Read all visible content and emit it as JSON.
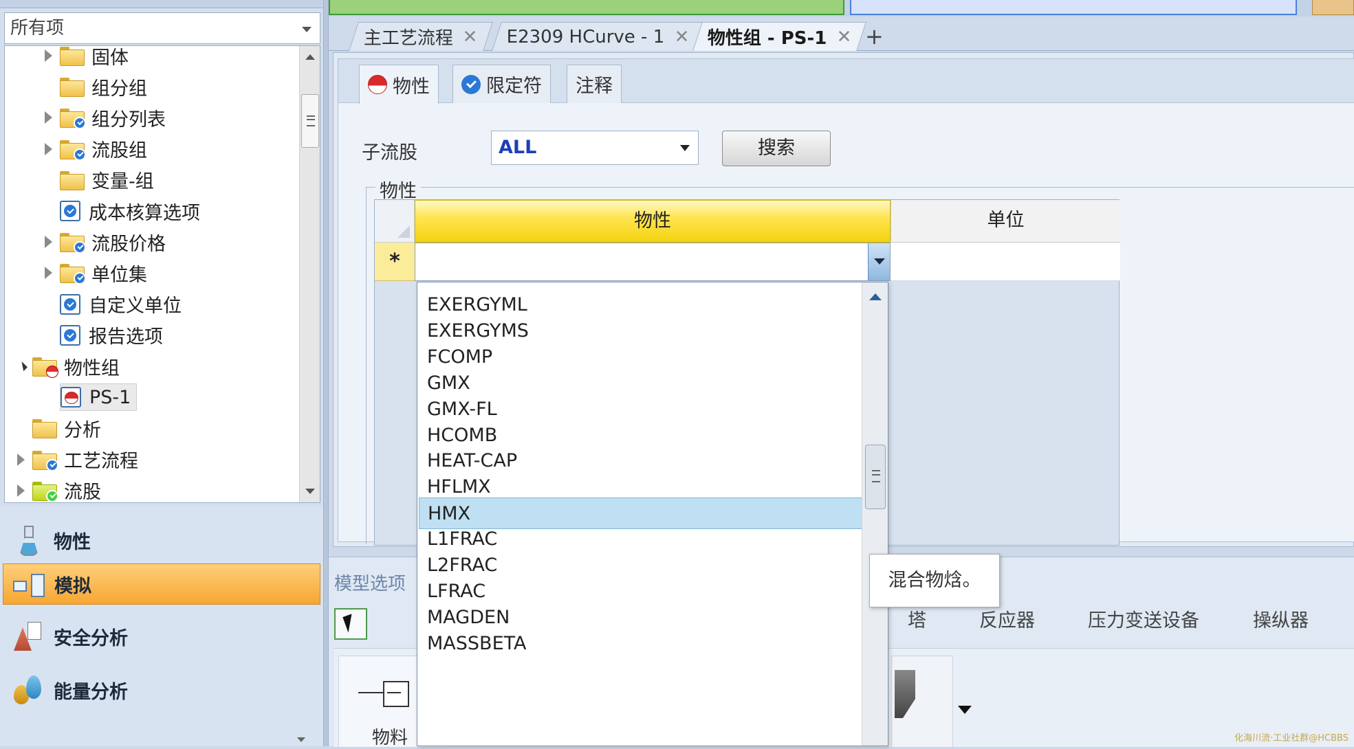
{
  "left_pane": {
    "filter": {
      "value": "所有项"
    },
    "tree": [
      {
        "label": "固体",
        "icon": "folder",
        "has_expander": true,
        "indent": 1
      },
      {
        "label": "组分组",
        "icon": "folder",
        "has_expander": false,
        "indent": 1
      },
      {
        "label": "组分列表",
        "icon": "folder-check",
        "has_expander": true,
        "indent": 1
      },
      {
        "label": "流股组",
        "icon": "folder-check",
        "has_expander": true,
        "indent": 1
      },
      {
        "label": "变量-组",
        "icon": "folder",
        "has_expander": false,
        "indent": 1
      },
      {
        "label": "成本核算选项",
        "icon": "form-check",
        "has_expander": false,
        "indent": 1
      },
      {
        "label": "流股价格",
        "icon": "folder-check",
        "has_expander": true,
        "indent": 1
      },
      {
        "label": "单位集",
        "icon": "folder-check",
        "has_expander": true,
        "indent": 1
      },
      {
        "label": "自定义单位",
        "icon": "form-check",
        "has_expander": false,
        "indent": 1
      },
      {
        "label": "报告选项",
        "icon": "form-check",
        "has_expander": false,
        "indent": 1
      },
      {
        "label": "物性组",
        "icon": "folder-red",
        "has_expander": true,
        "expanded": true,
        "indent": 0
      },
      {
        "label": "PS-1",
        "icon": "form-red",
        "has_expander": false,
        "indent": 1,
        "selected": true
      },
      {
        "label": "分析",
        "icon": "folder",
        "has_expander": false,
        "indent": 0
      },
      {
        "label": "工艺流程",
        "icon": "folder-check",
        "has_expander": true,
        "indent": 0
      },
      {
        "label": "流股",
        "icon": "folder-yellow",
        "has_expander": true,
        "indent": 0
      }
    ],
    "nav": [
      {
        "label": "物性",
        "icon": "flask-icon",
        "active": false
      },
      {
        "label": "模拟",
        "icon": "simulation-icon",
        "active": true
      },
      {
        "label": "安全分析",
        "icon": "safety-icon",
        "active": false
      },
      {
        "label": "能量分析",
        "icon": "energy-icon",
        "active": false
      }
    ]
  },
  "doc_tabs": [
    {
      "label": "主工艺流程",
      "active": false
    },
    {
      "label": "E2309 HCurve - 1",
      "active": false
    },
    {
      "label": "物性组 - PS-1",
      "active": true
    }
  ],
  "add_tab_label": "+",
  "close_glyph": "✕",
  "form": {
    "subtabs": [
      {
        "label": "物性",
        "icon": "red-status-icon",
        "active": true
      },
      {
        "label": "限定符",
        "icon": "check-status-icon",
        "active": false
      },
      {
        "label": "注释",
        "icon": "",
        "active": false
      }
    ],
    "substream_label": "子流股",
    "substream_value": "ALL",
    "search_label": "搜索",
    "group_label": "物性",
    "grid": {
      "col_property": "物性",
      "col_unit": "单位",
      "new_row_marker": "*"
    }
  },
  "dropdown": {
    "items": [
      "EXERGYML",
      "EXERGYMS",
      "FCOMP",
      "GMX",
      "GMX-FL",
      "HCOMB",
      "HEAT-CAP",
      "HFLMX",
      "HMX",
      "L1FRAC",
      "L2FRAC",
      "LFRAC",
      "MAGDEN",
      "MASSBETA"
    ],
    "selected": "HMX",
    "tooltip": "混合物焓。"
  },
  "model_library": {
    "tabs_label": "模型选项",
    "categories": [
      "塔",
      "反应器",
      "压力变送设备",
      "操纵器"
    ],
    "palette_item_label": "物料"
  },
  "watermark": "化海川流·工业社群@HCBBS",
  "colors": {
    "accent_orange": "#f7a632",
    "header_yellow": "#ffe552",
    "selection_blue": "#bfe0f2",
    "link_blue": "#1d3fb8"
  }
}
